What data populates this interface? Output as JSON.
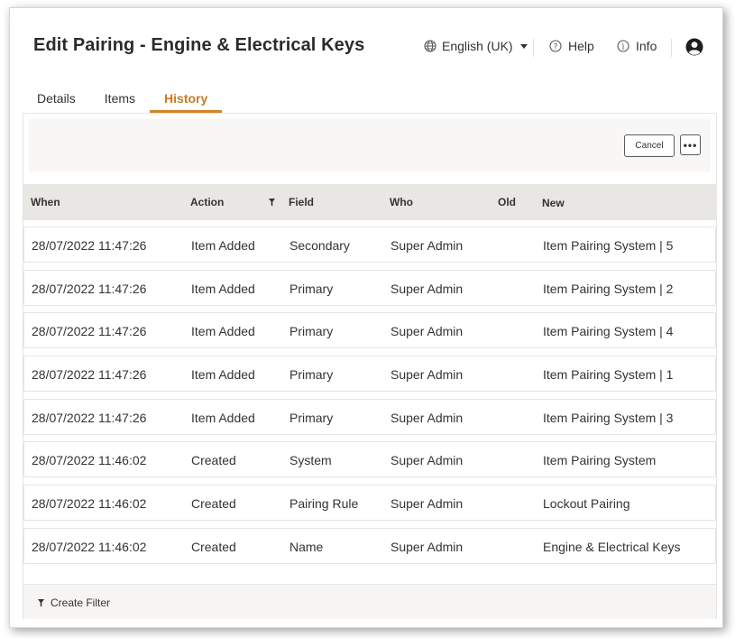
{
  "header": {
    "title": "Edit Pairing - Engine & Electrical Keys",
    "language": {
      "label": "English (UK)",
      "icon": "globe-icon"
    },
    "help_label": "Help",
    "info_label": "Info"
  },
  "tabs": [
    {
      "label": "Details",
      "active": false
    },
    {
      "label": "Items",
      "active": false
    },
    {
      "label": "History",
      "active": true
    }
  ],
  "toolbar": {
    "cancel_label": "Cancel",
    "more_label": "•••"
  },
  "table": {
    "columns": {
      "when": "When",
      "action": "Action",
      "field": "Field",
      "who": "Who",
      "old": "Old",
      "new": "New"
    },
    "rows": [
      {
        "when": "28/07/2022 11:47:26",
        "action": "Item Added",
        "field": "Secondary",
        "who": "Super Admin",
        "old": "",
        "new": "Item Pairing System | 5"
      },
      {
        "when": "28/07/2022 11:47:26",
        "action": "Item Added",
        "field": "Primary",
        "who": "Super Admin",
        "old": "",
        "new": "Item Pairing System | 2"
      },
      {
        "when": "28/07/2022 11:47:26",
        "action": "Item Added",
        "field": "Primary",
        "who": "Super Admin",
        "old": "",
        "new": "Item Pairing System | 4"
      },
      {
        "when": "28/07/2022 11:47:26",
        "action": "Item Added",
        "field": "Primary",
        "who": "Super Admin",
        "old": "",
        "new": "Item Pairing System | 1"
      },
      {
        "when": "28/07/2022 11:47:26",
        "action": "Item Added",
        "field": "Primary",
        "who": "Super Admin",
        "old": "",
        "new": "Item Pairing System | 3"
      },
      {
        "when": "28/07/2022 11:46:02",
        "action": "Created",
        "field": "System",
        "who": "Super Admin",
        "old": "",
        "new": "Item Pairing System"
      },
      {
        "when": "28/07/2022 11:46:02",
        "action": "Created",
        "field": "Pairing Rule",
        "who": "Super Admin",
        "old": "",
        "new": "Lockout Pairing"
      },
      {
        "when": "28/07/2022 11:46:02",
        "action": "Created",
        "field": "Name",
        "who": "Super Admin",
        "old": "",
        "new": "Engine & Electrical Keys"
      }
    ]
  },
  "footer": {
    "create_filter_label": "Create Filter"
  },
  "colors": {
    "accent": "#d4822a",
    "header_row_bg": "#e9e7e3",
    "toolbar_bg": "#f8f7f5"
  }
}
